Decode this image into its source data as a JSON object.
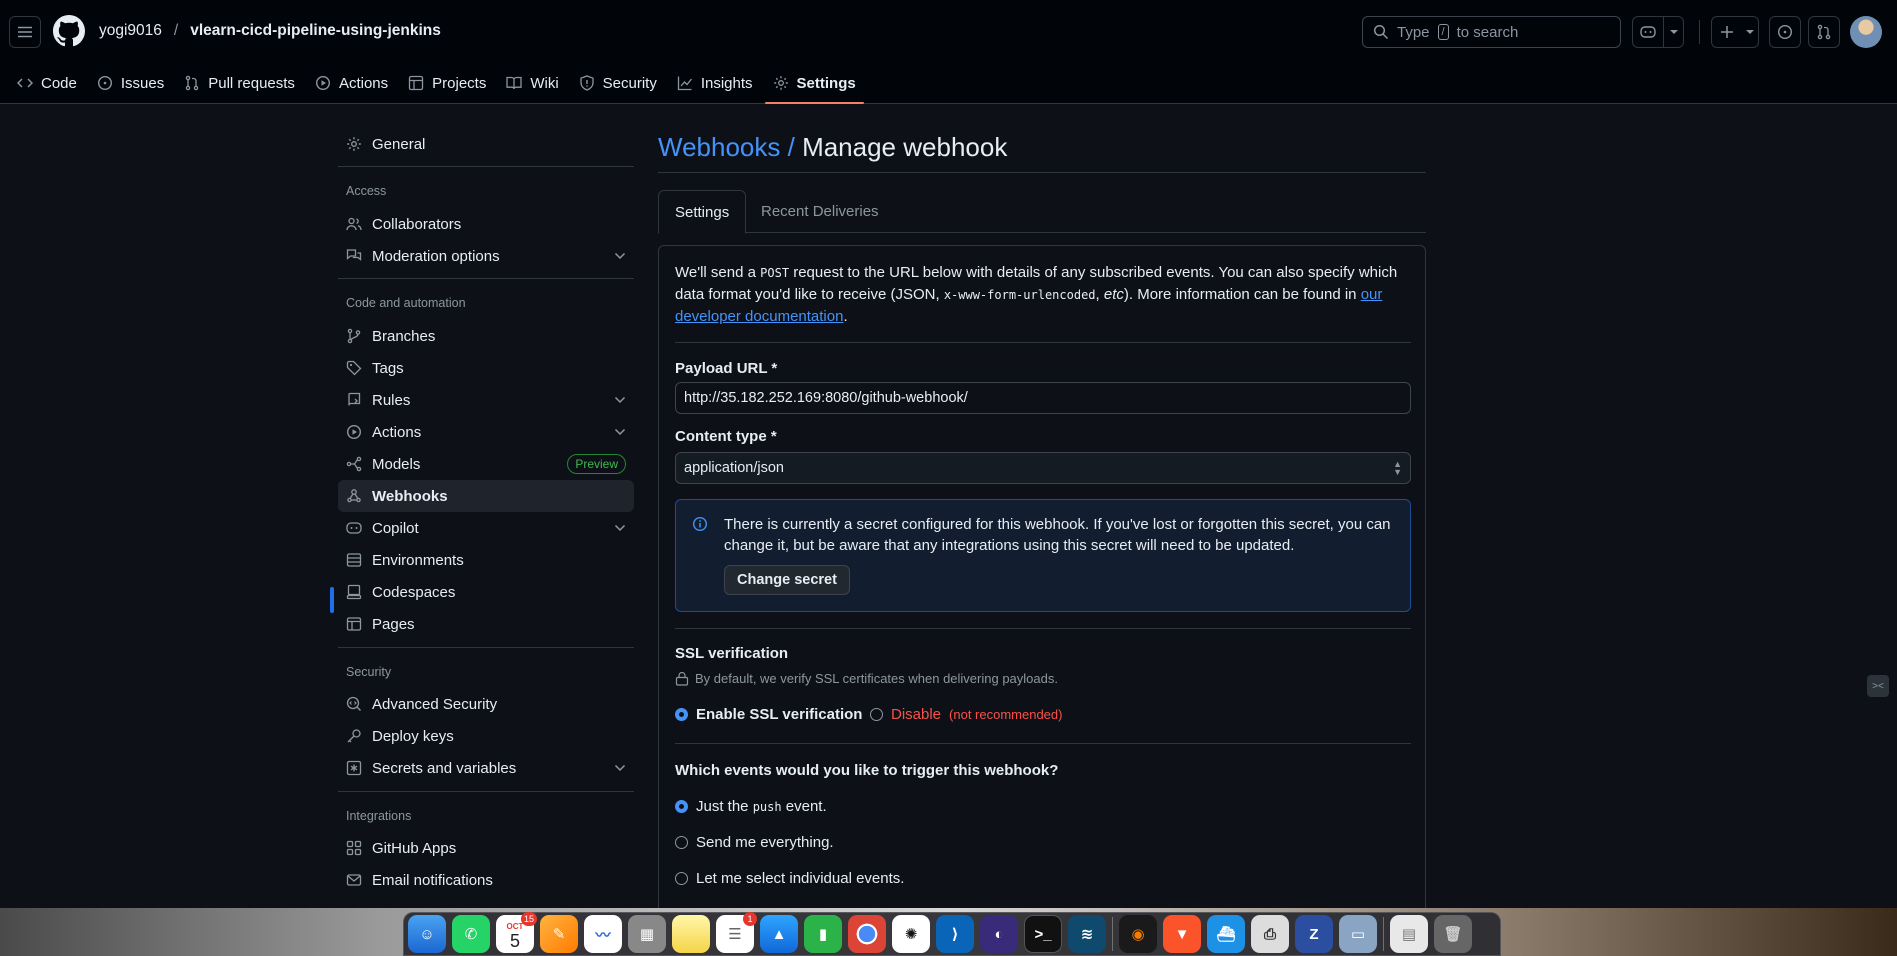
{
  "header": {
    "owner": "yogi9016",
    "separator": "/",
    "repo": "vlearn-cicd-pipeline-using-jenkins",
    "search_prefix": "Type",
    "search_key": "/",
    "search_suffix": "to search"
  },
  "repo_nav": [
    {
      "label": "Code",
      "icon": "code-icon"
    },
    {
      "label": "Issues",
      "icon": "issue-icon"
    },
    {
      "label": "Pull requests",
      "icon": "pull-request-icon"
    },
    {
      "label": "Actions",
      "icon": "play-icon"
    },
    {
      "label": "Projects",
      "icon": "table-icon"
    },
    {
      "label": "Wiki",
      "icon": "book-icon"
    },
    {
      "label": "Security",
      "icon": "shield-icon"
    },
    {
      "label": "Insights",
      "icon": "graph-icon"
    },
    {
      "label": "Settings",
      "icon": "gear-icon",
      "active": true
    }
  ],
  "sidebar": {
    "general": "General",
    "access_heading": "Access",
    "collaborators": "Collaborators",
    "moderation": "Moderation options",
    "code_heading": "Code and automation",
    "branches": "Branches",
    "tags": "Tags",
    "rules": "Rules",
    "actions": "Actions",
    "models": "Models",
    "models_badge": "Preview",
    "webhooks": "Webhooks",
    "copilot": "Copilot",
    "environments": "Environments",
    "codespaces": "Codespaces",
    "pages": "Pages",
    "security_heading": "Security",
    "advanced_security": "Advanced Security",
    "deploy_keys": "Deploy keys",
    "secrets": "Secrets and variables",
    "integrations_heading": "Integrations",
    "github_apps": "GitHub Apps",
    "email_notifications": "Email notifications"
  },
  "main": {
    "title_link": "Webhooks /",
    "title_rest": "Manage webhook",
    "tabs": [
      "Settings",
      "Recent Deliveries"
    ],
    "intro": {
      "p1": "We'll send a",
      "code1": "POST",
      "p2": "request to the URL below with details of any subscribed events. You can also specify which data format you'd like to receive (JSON,",
      "code2": "x-www-form-urlencoded",
      "p3": ",",
      "em": "etc",
      "p4": "). More information can be found in",
      "link": "our developer documentation",
      "p5": "."
    },
    "payload_label": "Payload URL *",
    "payload_value": "http://35.182.252.169:8080/github-webhook/",
    "content_type_label": "Content type *",
    "content_type_value": "application/json",
    "secret_notice": "There is currently a secret configured for this webhook. If you've lost or forgotten this secret, you can change it, but be aware that any integrations using this secret will need to be updated.",
    "change_secret": "Change secret",
    "ssl_label": "SSL verification",
    "ssl_note": "By default, we verify SSL certificates when delivering payloads.",
    "ssl_enable": "Enable SSL verification",
    "ssl_disable": "Disable",
    "ssl_disable_note": "(not recommended)",
    "events_question": "Which events would you like to trigger this webhook?",
    "event_push_1": "Just the",
    "event_push_code": "push",
    "event_push_2": "event.",
    "event_everything": "Send me everything.",
    "event_individual": "Let me select individual events."
  },
  "dock": {
    "calendar_month": "OCT",
    "calendar_day": "5",
    "calendar_badge": "15",
    "reminders_badge": "1"
  },
  "colors": {
    "accent": "#4493f8",
    "active_tab": "#f78166",
    "danger": "#f85149",
    "success": "#3fb950"
  }
}
